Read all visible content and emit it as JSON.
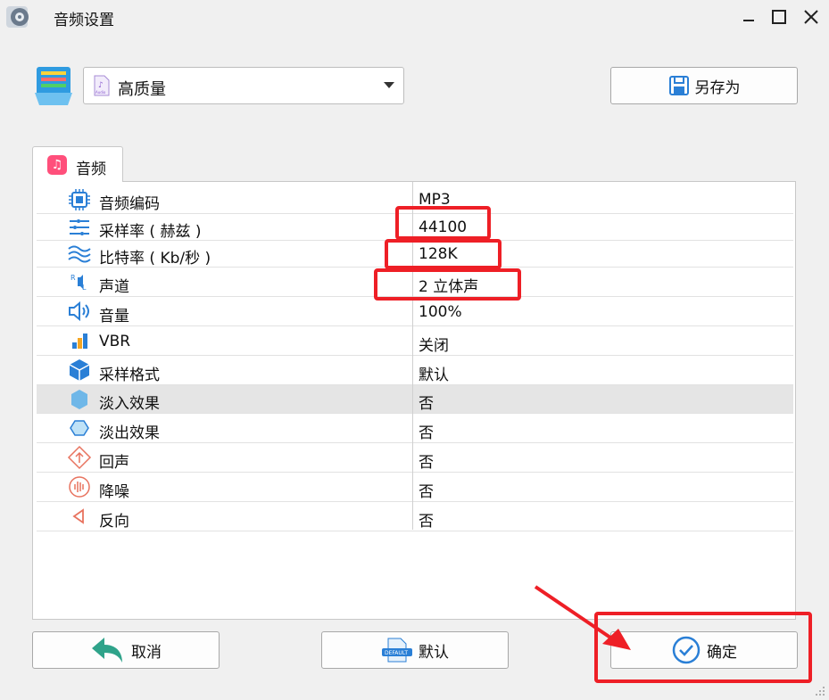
{
  "window": {
    "title": "音频设置"
  },
  "preset": {
    "value": "高质量",
    "file_icon_text": "Audio"
  },
  "buttons": {
    "save_as": "另存为",
    "cancel": "取消",
    "default": "默认",
    "default_icon_text": "DEFAULT",
    "ok": "确定"
  },
  "tab": {
    "label": "音频"
  },
  "settings": [
    {
      "name": "音频编码",
      "value": "MP3"
    },
    {
      "name": "采样率 ( 赫兹 )",
      "value": "44100"
    },
    {
      "name": "比特率 ( Kb/秒 )",
      "value": "128K"
    },
    {
      "name": "声道",
      "value": "2 立体声"
    },
    {
      "name": "音量",
      "value": "100%"
    },
    {
      "name": "VBR",
      "value": "关闭"
    },
    {
      "name": "采样格式",
      "value": "默认"
    },
    {
      "name": "淡入效果",
      "value": "否"
    },
    {
      "name": "淡出效果",
      "value": "否"
    },
    {
      "name": "回声",
      "value": "否"
    },
    {
      "name": "降噪",
      "value": "否"
    },
    {
      "name": "反向",
      "value": "否"
    }
  ],
  "colors": {
    "highlight": "#ee1f26",
    "accent_blue": "#2a7fd6",
    "selected_row": "#e5e5e5"
  },
  "icons": [
    "app-icon",
    "minimize-icon",
    "maximize-icon",
    "close-icon",
    "preset-list-icon",
    "audio-file-icon",
    "save-disk-icon",
    "music-note-icon",
    "chip-icon",
    "sample-rate-icon",
    "wave-icon",
    "channel-icon",
    "speaker-icon",
    "vbr-icon",
    "cube-icon",
    "hexagon-fill-icon",
    "hexagon-outline-icon",
    "echo-icon",
    "noise-icon",
    "reverse-icon",
    "undo-arrow-icon",
    "default-doc-icon",
    "check-circle-icon"
  ]
}
